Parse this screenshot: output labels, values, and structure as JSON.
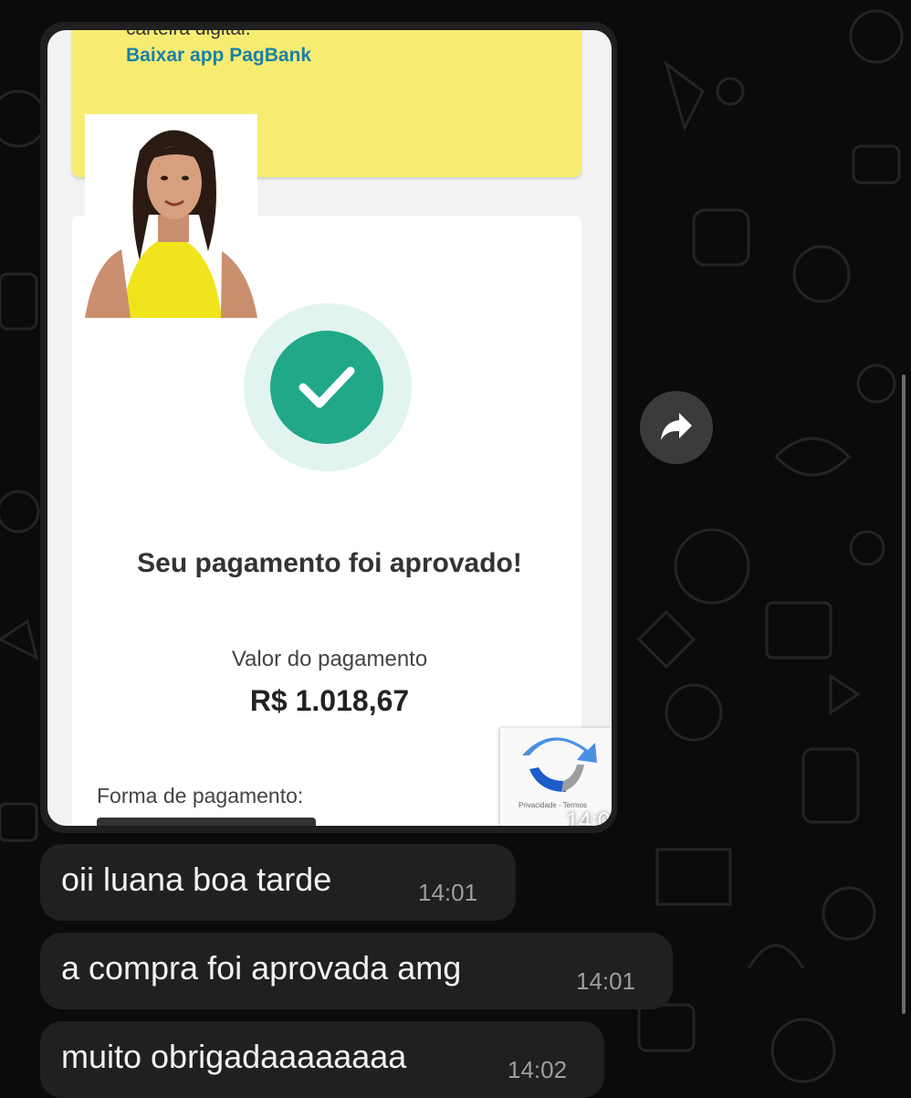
{
  "image_message": {
    "card_text": "carteira digital.",
    "download_link": "Baixar app PagBank",
    "success_title": "Seu pagamento foi aprovado!",
    "amount_label": "Valor do pagamento",
    "amount_value": "R$ 1.018,67",
    "method_label": "Forma de pagamento:",
    "recaptcha_text": "Privacidade - Termos",
    "time": "14:01"
  },
  "messages": [
    {
      "text": "oii luana boa tarde",
      "time": "14:01"
    },
    {
      "text": "a compra foi aprovada amg",
      "time": "14:01"
    },
    {
      "text": "muito obrigadaaaaaaaa",
      "time": "14:02"
    }
  ],
  "colors": {
    "background": "#0b0b0b",
    "bubble": "#202020",
    "pagbank_yellow": "#f7ec72",
    "success_green": "#20a888",
    "link_blue": "#1b7fa6"
  },
  "icons": {
    "forward": "forward-arrow-icon",
    "success": "checkmark-icon",
    "recaptcha": "recaptcha-logo-icon"
  }
}
